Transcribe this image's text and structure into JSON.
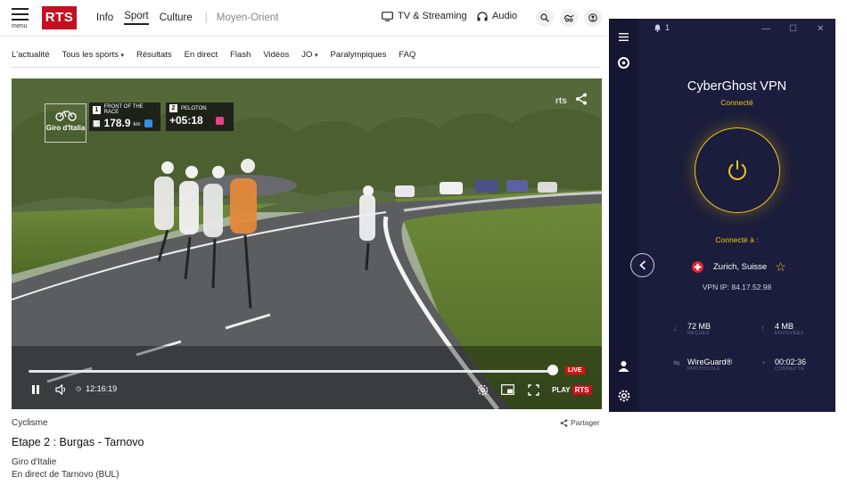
{
  "header": {
    "menu_label": "menu",
    "logo_text": "RTS",
    "nav": [
      "Info",
      "Sport",
      "Culture"
    ],
    "nav_extra": "Moyen-Orient",
    "tv_label": "TV & Streaming",
    "audio_label": "Audio"
  },
  "subnav": {
    "items": [
      "L'actualité",
      "Tous les sports",
      "Résultats",
      "En direct",
      "Flash",
      "Vidéos",
      "JO",
      "Paralympiques",
      "FAQ"
    ]
  },
  "video": {
    "channel_watermark": "rts",
    "logo_text": "Giro d'Italia",
    "hud": {
      "box1_num": "1",
      "box1_label": "FRONT OF THE RACE",
      "box1_value": "178.9",
      "box1_unit": "km",
      "box2_num": "2",
      "box2_label": "PELOTON",
      "box2_value": "+05:18"
    },
    "live_label": "LIVE",
    "time": "12:16:19",
    "play_label": "PLAY",
    "play_brand": "RTS",
    "progress": 0.99
  },
  "article": {
    "category": "Cyclisme",
    "share_label": "Partager",
    "title": "Etape 2 : Burgas - Tarnovo",
    "subtitle1": "Giro d'Italie",
    "subtitle2": "En direct de Tarnovo (BUL)"
  },
  "vpn": {
    "notification_count": "1",
    "app_name": "CyberGhost VPN",
    "status": "Connecté",
    "connected_to_label": "Connecté à :",
    "location": "Zurich, Suisse",
    "ip": "VPN IP: 84.17.52.98",
    "download_value": "72 MB",
    "download_label": "REÇUES",
    "upload_value": "4 MB",
    "upload_label": "ENVOYÉES",
    "protocol_value": "WireGuard®",
    "protocol_label": "PROTOCOLE",
    "connected_time": "00:02:36",
    "connected_time_label": "CONNECTÉ"
  },
  "colors": {
    "rts_red": "#c50f1f",
    "vpn_bg": "#1a1d3b",
    "vpn_accent": "#f5c518"
  }
}
